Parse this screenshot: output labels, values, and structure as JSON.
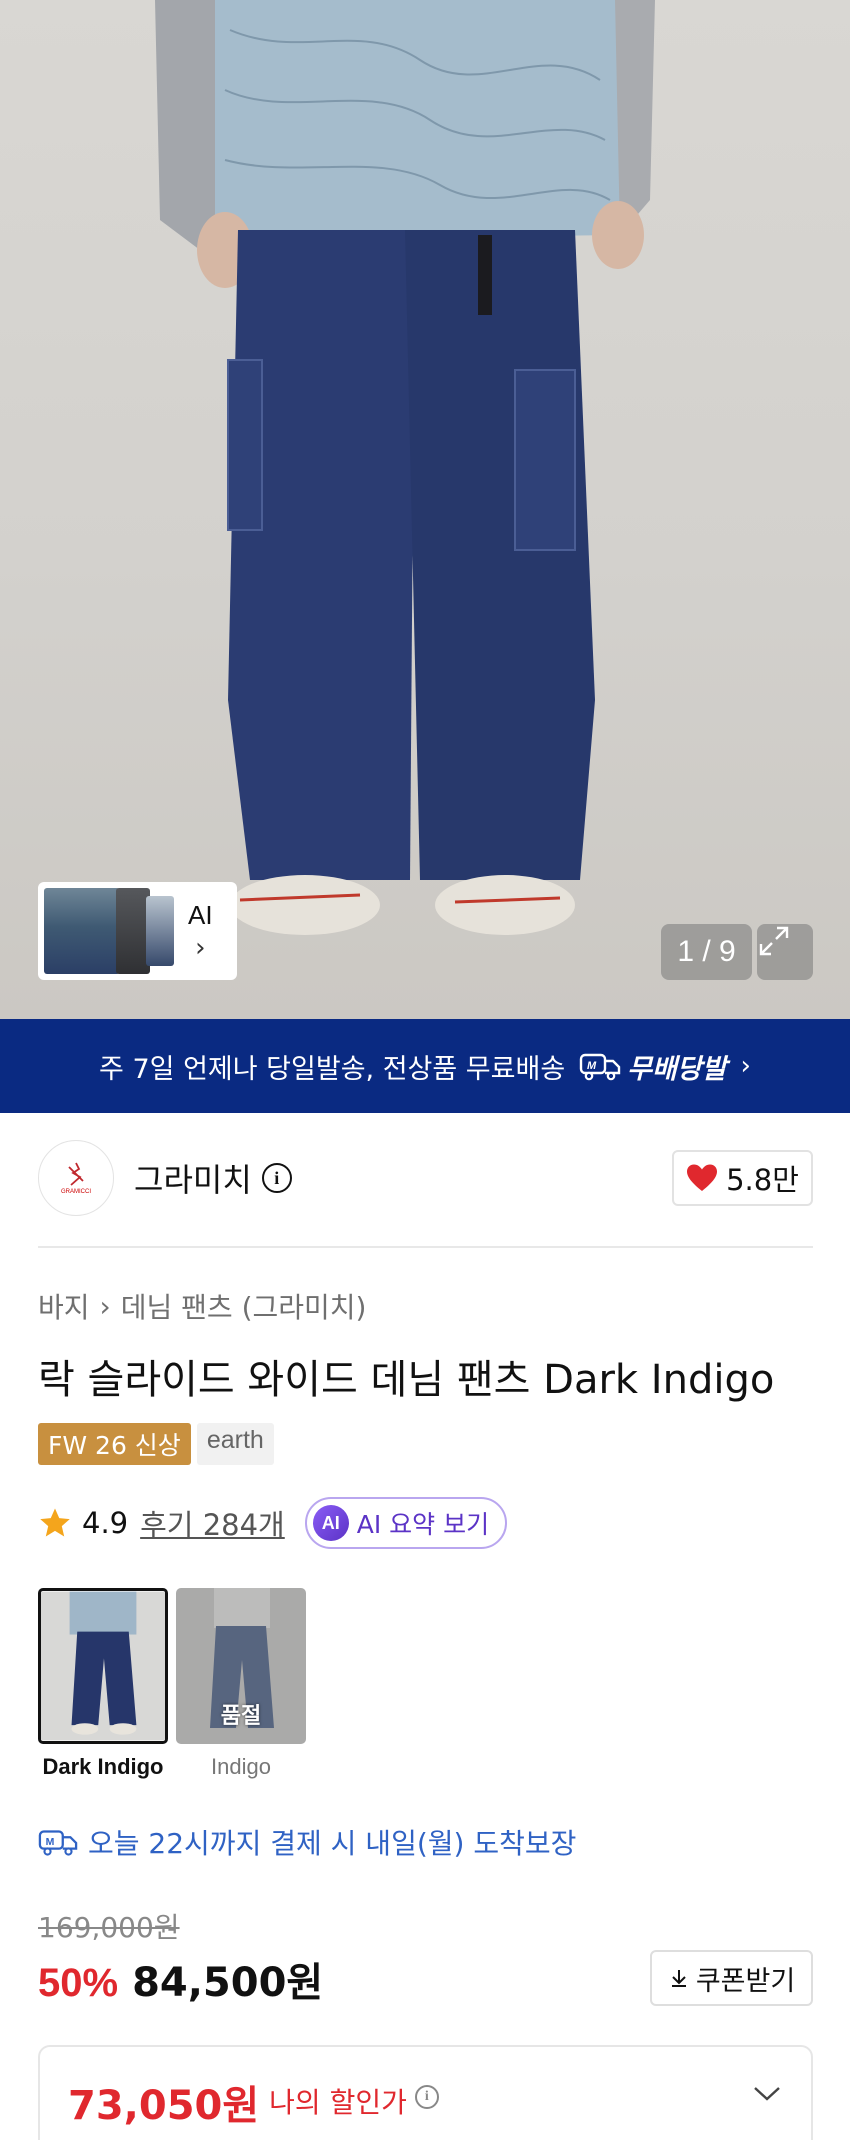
{
  "gallery": {
    "thumbnail_label": "AI",
    "counter": "1 / 9"
  },
  "banner": {
    "text": "주 7일 언제나 당일발송, 전상품 무료배송",
    "service_name": "무배당발"
  },
  "brand": {
    "name": "그라미치",
    "likes": "5.8만",
    "like_color": "#e0282e"
  },
  "breadcrumb": [
    "바지",
    "데님 팬츠 (그라미치)"
  ],
  "product": {
    "title": "락 슬라이드 와이드 데님 팬츠 Dark Indigo",
    "tags": [
      "FW 26 신상",
      "earth"
    ],
    "rating": "4.9",
    "reviews": "후기 284개",
    "ai_summary": "AI 요약 보기"
  },
  "colors": [
    {
      "name": "Dark Indigo",
      "selected": true
    },
    {
      "name": "Indigo",
      "selected": false,
      "status": "품절"
    }
  ],
  "delivery": {
    "text": "오늘 22시까지 결제 시 내일(월) 도착보장"
  },
  "price": {
    "original": "169,000원",
    "discount": "50%",
    "sale": "84,500원",
    "coupon_label": "쿠폰받기",
    "my_price": "73,050원",
    "my_price_label": "나의 할인가"
  },
  "icons": {
    "brand_info": "info-icon",
    "like": "heart-icon",
    "rating": "star-icon",
    "delivery": "truck-icon",
    "expand": "expand-icon",
    "coupon": "download-icon",
    "dropdown": "chevron-down-icon"
  },
  "theme": {
    "banner_bg": "#0a2a82",
    "accent_red": "#e0282e",
    "delivery_blue": "#2f62c4",
    "new_tag": "#c8903f"
  }
}
